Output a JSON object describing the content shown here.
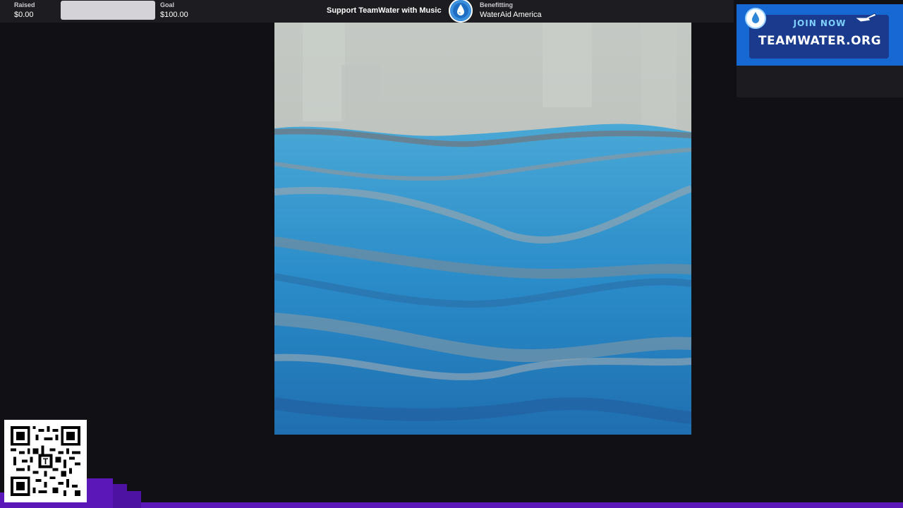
{
  "donation_bar": {
    "raised_label": "Raised",
    "raised_value": "$0.00",
    "goal_label": "Goal",
    "goal_value": "$100.00",
    "progress_fraction": 0.0,
    "campaign_title": "Support TeamWater with Music",
    "benefit_label": "Benefitting",
    "benefit_value": "WaterAid America"
  },
  "promo": {
    "join_text": "JOIN NOW",
    "site_text": "TEAMWATER.ORG"
  },
  "qr": {
    "center_letter": "T"
  },
  "colors": {
    "background": "#111014",
    "bar_background": "#1d1c21",
    "progress_track": "#d4d4d8",
    "accent_blue": "#1668d3",
    "equalizer_purple": "#5b17b8",
    "water_blue": "#2f9ad4"
  },
  "icons": {
    "charity_logo": "water-drop-logo-icon",
    "promo_logo": "water-drop-icon",
    "promo_pointer": "pointing-hand-icon",
    "qr": "qr-code-icon"
  }
}
